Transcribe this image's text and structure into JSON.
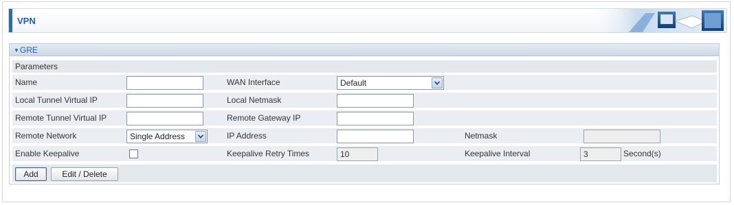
{
  "header": {
    "title": "VPN"
  },
  "section": {
    "title": "GRE"
  },
  "parameters": {
    "heading": "Parameters"
  },
  "fields": {
    "name": {
      "label": "Name",
      "value": ""
    },
    "wan_interface": {
      "label": "WAN Interface",
      "selected": "Default"
    },
    "local_tunnel_virtual_ip": {
      "label": "Local Tunnel Virtual IP",
      "value": ""
    },
    "local_netmask": {
      "label": "Local Netmask",
      "value": ""
    },
    "remote_tunnel_virtual_ip": {
      "label": "Remote Tunnel Virtual IP",
      "value": ""
    },
    "remote_gateway_ip": {
      "label": "Remote Gateway IP",
      "value": ""
    },
    "remote_network": {
      "label": "Remote Network",
      "selected": "Single Address"
    },
    "ip_address": {
      "label": "IP Address",
      "value": ""
    },
    "netmask": {
      "label": "Netmask",
      "value": ""
    },
    "enable_keepalive": {
      "label": "Enable Keepalive",
      "checked": false
    },
    "keepalive_retry_times": {
      "label": "Keepalive Retry Times",
      "value": "10"
    },
    "keepalive_interval": {
      "label": "Keepalive Interval",
      "value": "3",
      "unit": "Second(s)"
    }
  },
  "buttons": {
    "add": "Add",
    "edit_delete": "Edit / Delete"
  },
  "colors": {
    "accent": "#1f6fbf",
    "title_text": "#1f5faa",
    "row_bg": "#eaeef2"
  }
}
